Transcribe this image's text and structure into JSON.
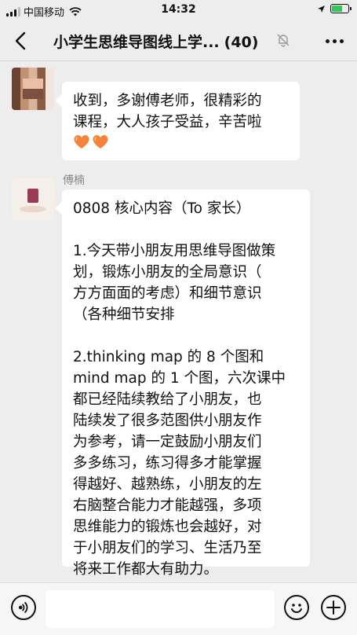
{
  "status_bar": {
    "carrier": "中国移动",
    "time": "14:32",
    "icons": [
      "signal-icon",
      "wifi-icon",
      "location-icon",
      "battery-icon"
    ]
  },
  "nav": {
    "title": "小学生思维导图线上学...",
    "member_count": "(40)",
    "icons": [
      "back-icon",
      "mute-icon",
      "more-icon"
    ]
  },
  "messages": [
    {
      "lines": [
        "收到，多谢傅老师，很精彩的",
        "课程，大人孩子受益，辛苦啦"
      ],
      "emoji": [
        "orange-heart-icon",
        "orange-heart-icon"
      ]
    },
    {
      "sender": "傅楠",
      "lines": [
        "0808 核心内容（To 家长）",
        "",
        "1.今天带小朋友用思维导图做策",
        "划，锻炼小朋友的全局意识（",
        "方方面面的考虑）和细节意识",
        "（各种细节安排",
        "",
        "2.thinking map 的 8 个图和",
        "mind map 的 1 个图，六次课中",
        "都已经陆续教给了小朋友，也",
        "陆续发了很多范图供小朋友作",
        "为参考，请一定鼓励小朋友们",
        "多多练习，练习得多才能掌握",
        "得越好、越熟练，小朋友的左",
        "右脑整合能力才能越强，多项",
        "思维能力的锻炼也会越好，对",
        "于小朋友们的学习、生活乃至",
        "将来工作都大有助力。"
      ]
    }
  ],
  "input_bar": {
    "icons": [
      "voice-icon",
      "emoji-icon",
      "plus-icon"
    ]
  },
  "colors": {
    "background": "#ededed",
    "bubble": "#ffffff",
    "heart": "#f5833a"
  }
}
